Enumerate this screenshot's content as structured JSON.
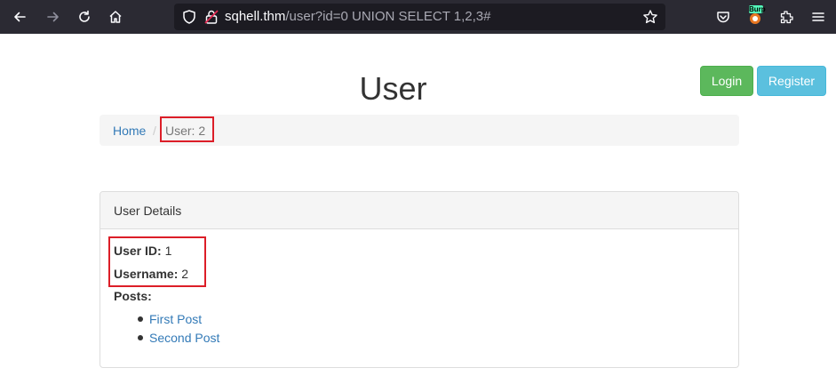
{
  "browser": {
    "url_host": "sqhell.thm",
    "url_path": "/user?id=0 UNION SELECT 1,2,3#",
    "burp_badge": "Burp"
  },
  "page": {
    "title": "User",
    "login_label": "Login",
    "register_label": "Register",
    "breadcrumb": {
      "home": "Home",
      "separator": "/",
      "active": "User: 2"
    }
  },
  "panel": {
    "heading": "User Details",
    "user_id_label": "User ID:",
    "user_id_value": "1",
    "username_label": "Username:",
    "username_value": "2",
    "posts_label": "Posts:",
    "posts": [
      "First Post",
      "Second Post"
    ]
  },
  "colors": {
    "toolbar_bg": "#2b2a33",
    "highlight": "#dc1e28",
    "login_green": "#5cb85c",
    "register_blue": "#5bc0de",
    "link_blue": "#337ab7"
  }
}
